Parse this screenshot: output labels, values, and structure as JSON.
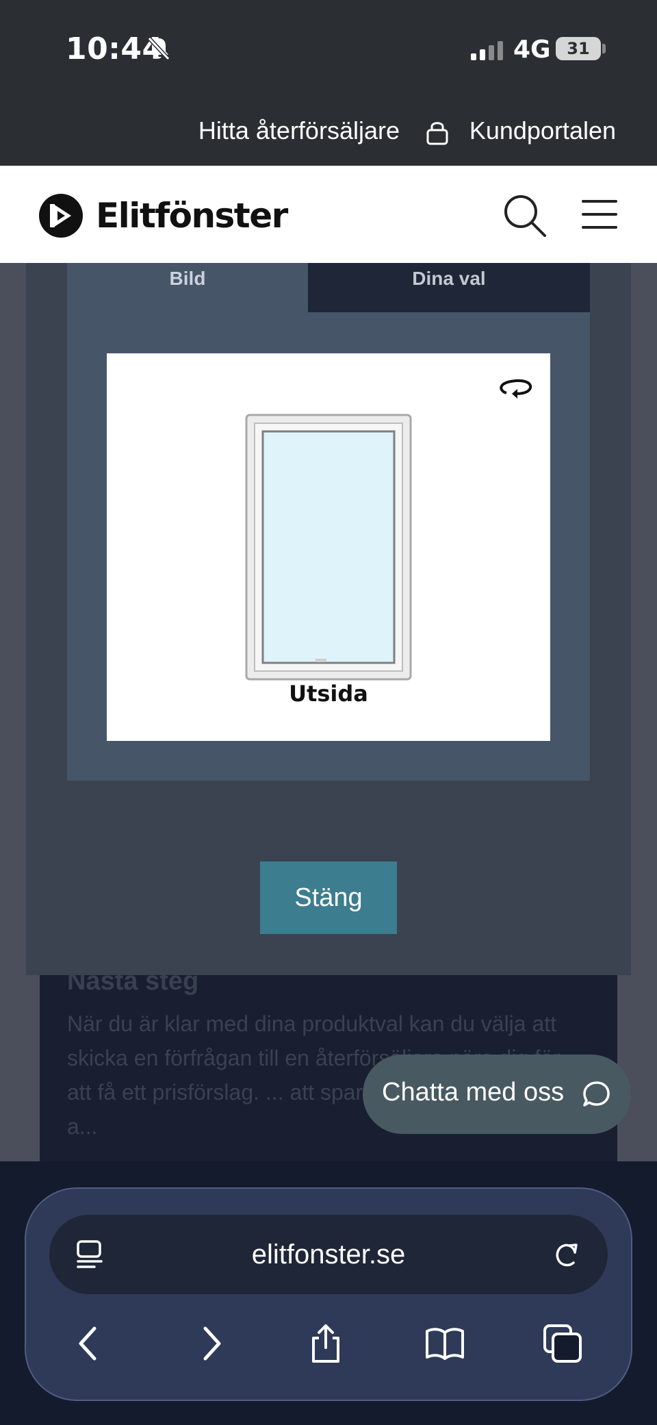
{
  "status_bar": {
    "time": "10:44",
    "network": "4G",
    "battery": "31"
  },
  "top_links": {
    "dealer": "Hitta återförsäljare",
    "portal": "Kundportalen"
  },
  "header": {
    "logo": "Elitfönster"
  },
  "modal": {
    "tabs": [
      {
        "label": "Bild",
        "active": true
      },
      {
        "label": "Dina val",
        "active": false
      }
    ],
    "preview_caption": "Utsida",
    "close_label": "Stäng"
  },
  "page": {
    "next_title": "Nästa steg",
    "next_text": "När du är klar med dina produktval kan du välja att skicka en förfrågan till en återförsäljare nära dig för att få ett prisförslag. ... att spara dina produkter för a..."
  },
  "chat": {
    "label": "Chatta med oss"
  },
  "browser": {
    "url": "elitfonster.se"
  },
  "colors": {
    "header_dark": "#2b2f33",
    "modal_bg": "#3b4250",
    "tab_active": "#475569",
    "tab_inactive": "#1e2638",
    "close_button": "#3c7d8f",
    "chat_button": "#495961",
    "glass": "#def4fb"
  },
  "icons": [
    "bell-off-icon",
    "signal-icon",
    "lock-icon",
    "search-icon",
    "menu-icon",
    "rotate-icon",
    "chat-bubble-icon",
    "reader-icon",
    "reload-icon",
    "back-icon",
    "forward-icon",
    "share-icon",
    "bookmarks-icon",
    "tabs-icon"
  ]
}
